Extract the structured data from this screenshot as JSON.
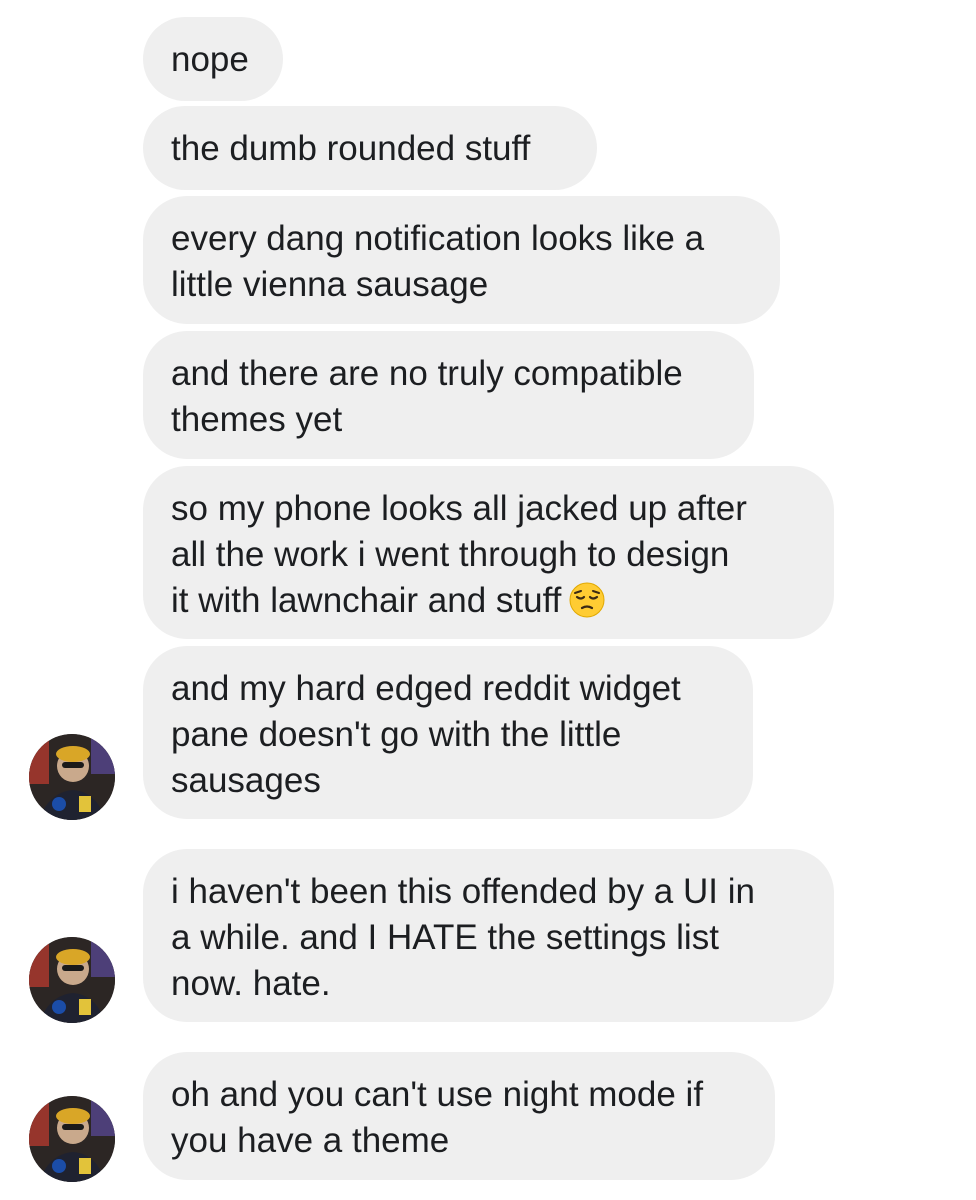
{
  "conversation": {
    "messages": [
      {
        "text": "nope"
      },
      {
        "text": "the dumb rounded stuff"
      },
      {
        "text": "every dang notification looks like a\nlittle vienna sausage"
      },
      {
        "text": "and there are no truly compatible\nthemes yet"
      },
      {
        "text": "so my phone looks all jacked up after\nall the work i went through to design\nit with lawnchair and stuff",
        "emoji": "pensive-face-emoji"
      },
      {
        "text": "and my hard edged reddit widget\npane doesn't go with the little\nsausages"
      },
      {
        "text": "i haven't been this offended by a UI in\na while. and I HATE the settings list\nnow. hate."
      },
      {
        "text": "oh and you can't use night mode if\nyou have a theme"
      }
    ]
  },
  "colors": {
    "bubble_bg": "#efefef",
    "text": "#1c1e21",
    "page_bg": "#ffffff"
  }
}
